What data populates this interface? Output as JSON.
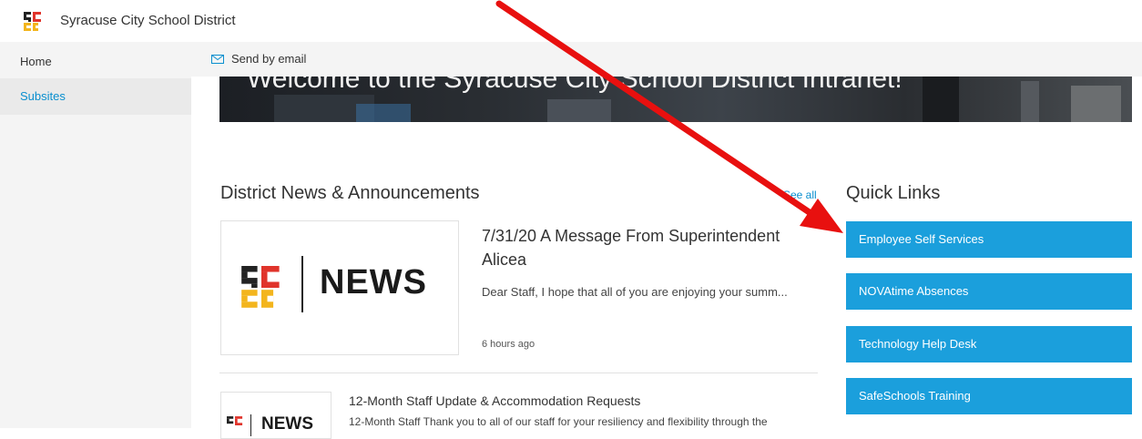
{
  "site": {
    "title": "Syracuse City School District"
  },
  "nav": {
    "items": [
      {
        "label": "Home"
      },
      {
        "label": "Subsites"
      }
    ]
  },
  "commandbar": {
    "send_email": "Send by email",
    "icon": "mail-icon"
  },
  "hero": {
    "title": "Welcome to the Syracuse City School District Intranet!"
  },
  "news": {
    "heading": "District News & Announcements",
    "see_all": "See all",
    "logo_text": "NEWS",
    "items": [
      {
        "title": "7/31/20 A Message From Superintendent Alicea",
        "description": "Dear Staff, I hope that all of you are enjoying your summ...",
        "time": "6 hours ago"
      },
      {
        "title": "12-Month Staff Update & Accommodation Requests",
        "description": "12-Month Staff Thank you to all of our staff for your resiliency and flexibility through the"
      }
    ]
  },
  "quick_links": {
    "heading": "Quick Links",
    "items": [
      {
        "label": "Employee Self Services"
      },
      {
        "label": "NOVAtime Absences"
      },
      {
        "label": "Technology Help Desk"
      },
      {
        "label": "SafeSchools Training"
      }
    ]
  },
  "colors": {
    "accent": "#1b9fdc",
    "link": "#0a8fcf",
    "annotation_arrow": "#e8100f"
  }
}
